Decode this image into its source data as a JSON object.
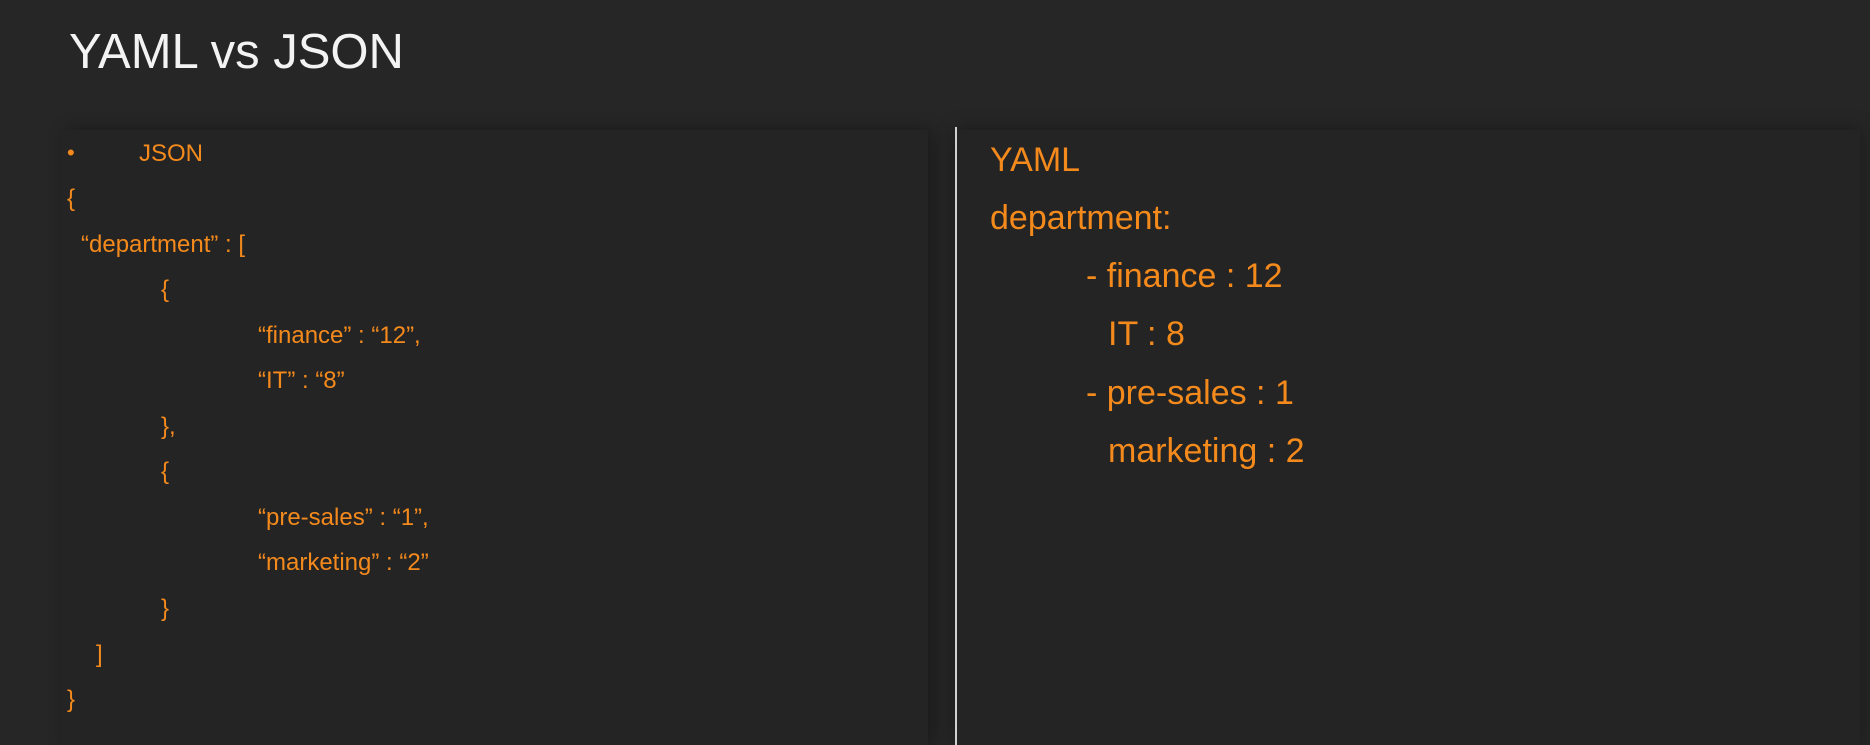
{
  "slide": {
    "title": "YAML vs JSON",
    "bullet": "•",
    "json": {
      "heading": "JSON",
      "lines": [
        "{",
        "“department” : [",
        "{",
        "“finance” : “12”,",
        "“IT” : “8”",
        "},",
        "{",
        "“pre-sales” : “1”,",
        "“marketing” : “2”",
        "}",
        "]",
        "}"
      ]
    },
    "yaml": {
      "heading": "YAML",
      "lines": [
        "department:",
        "- finance : 12",
        "IT : 8",
        "- pre-sales : 1",
        "marketing : 2"
      ]
    }
  },
  "colors": {
    "background": "#262627",
    "title": "#f3f3f3",
    "code": "#f48a1c",
    "divider": "#d0d0d0"
  }
}
